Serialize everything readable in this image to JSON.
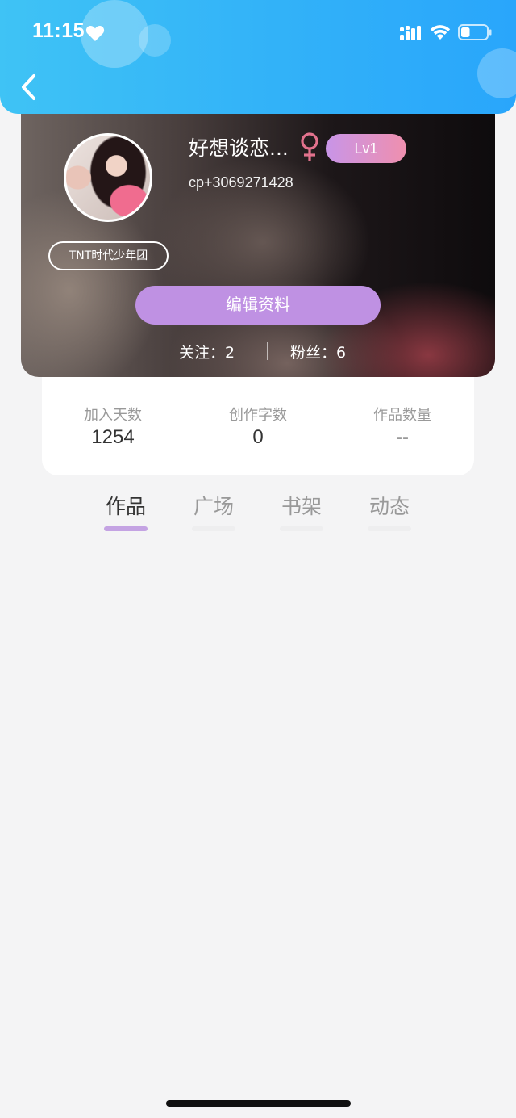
{
  "status_bar": {
    "time": "11:15",
    "icons": [
      "heart-icon",
      "cellular-signal-icon",
      "wifi-icon",
      "battery-icon"
    ],
    "battery_level": 0.35
  },
  "header": {
    "back_icon": "chevron-left-icon",
    "gradient_colors": [
      "#3fc3f5",
      "#29a6fb"
    ]
  },
  "profile": {
    "username": "好想谈恋...",
    "gender_icon": "female-symbol-icon",
    "level": "Lv1",
    "user_id": "cp+3069271428",
    "tag": "TNT时代少年团",
    "edit_button": "编辑资料",
    "following": "关注：2",
    "fans": "粉丝：6"
  },
  "stats": [
    {
      "label": "加入天数",
      "value": "1254"
    },
    {
      "label": "创作字数",
      "value": "0"
    },
    {
      "label": "作品数量",
      "value": "--"
    }
  ],
  "tabs": [
    {
      "label": "作品",
      "active": true
    },
    {
      "label": "广场",
      "active": false
    },
    {
      "label": "书架",
      "active": false
    },
    {
      "label": "动态",
      "active": false
    }
  ],
  "colors": {
    "accent_purple": "#bf91e3",
    "tab_indicator": "#c4a3e3",
    "gender_pink": "#e2728d"
  }
}
